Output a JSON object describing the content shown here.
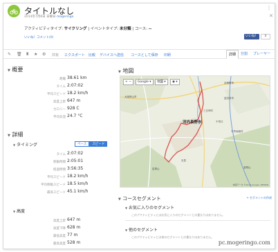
{
  "header": {
    "title": "タイトルなし",
    "subtitle_date": "2014年7月6日 日曜日",
    "subtitle_user": "mogeringo",
    "activity_prefix": "アクティビティタイプ:",
    "activity_type": "サイクリング",
    "event_prefix": "| イベントタイプ:",
    "event_type": "未分類",
    "course_prefix": "| コース:",
    "course_value": "--",
    "like_link": "いいね！コメント(0)",
    "fb_label": "いいね！",
    "fb_count": "0"
  },
  "toolbar": {
    "links": [
      "共有",
      "エクスポート",
      "比較",
      "デバイスへ送信",
      "コースとして保存",
      "印刷"
    ],
    "tabs": [
      "詳細",
      "分割",
      "プレーヤー"
    ]
  },
  "summary": {
    "heading": "概要",
    "rows": [
      {
        "label": "距離",
        "value": "38.61 km"
      },
      {
        "label": "タイム",
        "value": "2:07:02"
      },
      {
        "label": "平均スピード",
        "value": "18.2 km/h"
      },
      {
        "label": "高度上昇",
        "value": "647 m"
      },
      {
        "label": "カロリー",
        "value": "928 C"
      },
      {
        "label": "平均気温",
        "value": "24.7 °C"
      }
    ]
  },
  "details": {
    "heading": "詳細",
    "timing_heading": "タイミング",
    "toggle_pace": "ペース",
    "toggle_speed": "スピード",
    "timing_rows": [
      {
        "label": "タイム",
        "value": "2:07:02"
      },
      {
        "label": "移動時間",
        "value": "2:05:01"
      },
      {
        "label": "経過時間",
        "value": "3:56:35"
      },
      {
        "label": "平均スピード",
        "value": "18.2 km/h"
      },
      {
        "label": "平均移動スピード",
        "value": "18.5 km/h"
      },
      {
        "label": "最高スピード",
        "value": "45.1 km/h"
      }
    ],
    "elevation_heading": "高度",
    "elevation_rows": [
      {
        "label": "高度上昇",
        "value": "647 m"
      },
      {
        "label": "高度下降",
        "value": "628 m"
      },
      {
        "label": "最低高度",
        "value": "77 m"
      },
      {
        "label": "最高高度",
        "value": "528 m"
      }
    ]
  },
  "map": {
    "heading": "地図",
    "ctl_google": "Google",
    "ctl_terrain": "地図",
    "city": "河内長野市",
    "labels": [
      "大阪狭山市",
      "富田林市",
      "羽曳野市",
      "千早赤阪村",
      "金剛山",
      "岩湧山",
      "天見",
      "三日市町",
      "千早口"
    ],
    "copyright": "地図データ ©2014 Google, ZENRIN"
  },
  "segments": {
    "heading": "コースセグメント",
    "link": "+ セグメントの作成",
    "fav_heading": "お気に入りのセグメント",
    "fav_note": "このアクティビティにはお気に入りのセグメントとの重なりはありません。",
    "other_heading": "他のセグメント",
    "other_note": "このアクティビティには他のセグメントとの重なりはありません。"
  },
  "watermark": "pc.mogeringo.com",
  "colors": {
    "accent": "#3a7bd5",
    "icon_green": "#8ec63f",
    "route_red": "#d9534f",
    "fb_blue": "#3b5998"
  }
}
